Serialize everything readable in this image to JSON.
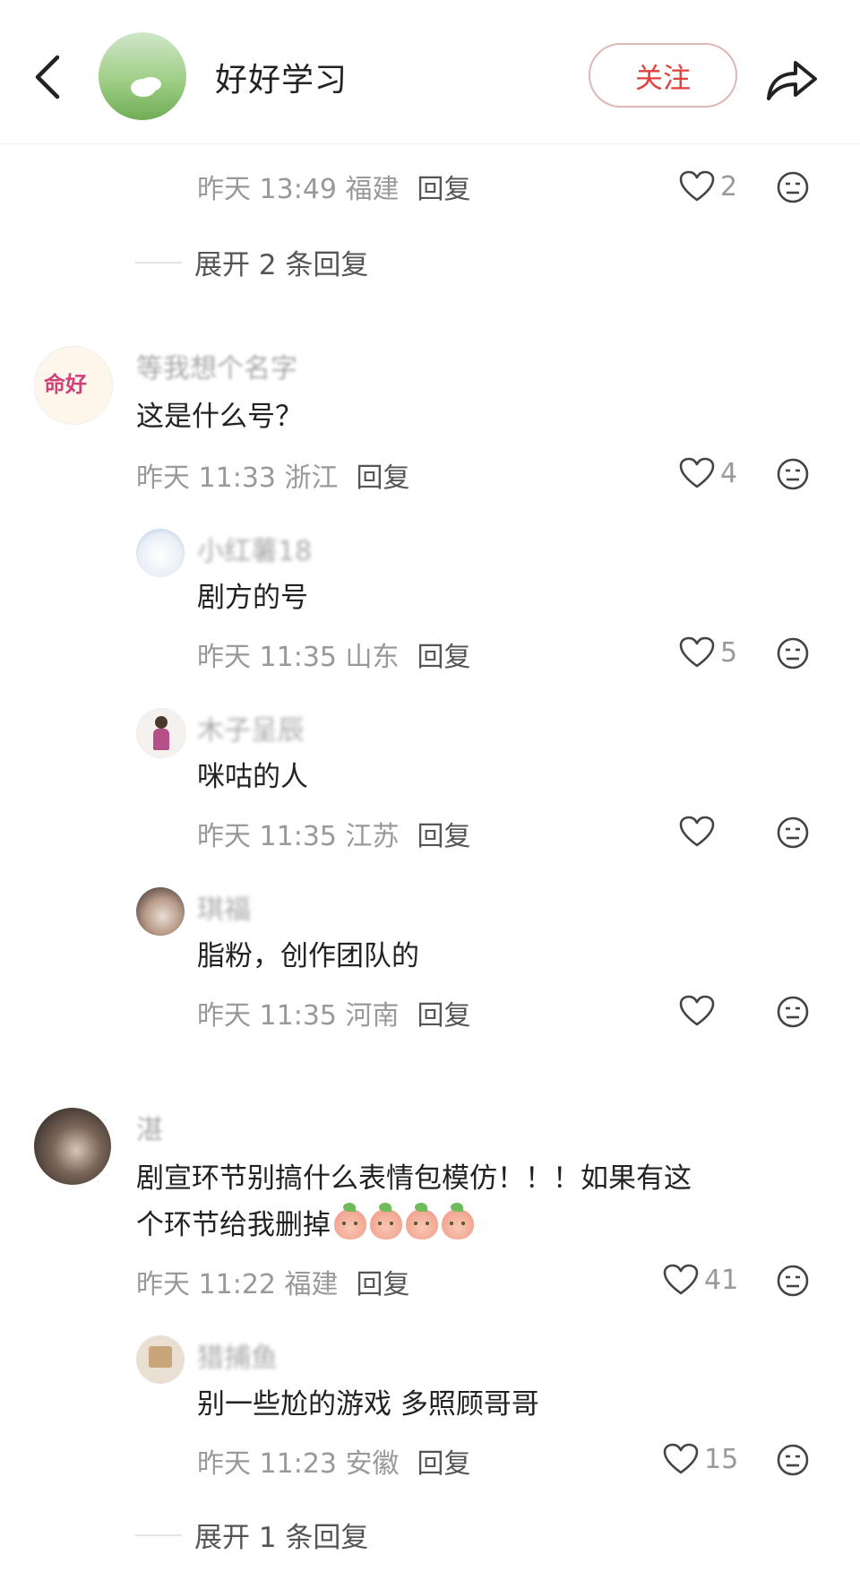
{
  "header": {
    "title": "好好学习",
    "follow_label": "关注",
    "icons": [
      "back-arrow-icon",
      "share-icon"
    ]
  },
  "top_partial": {
    "meta": "昨天 13:49 福建",
    "reply_label": "回复",
    "likes": "2",
    "expand_label": "展开 2 条回复"
  },
  "comments": [
    {
      "username": "等我想个名字",
      "avatar_text": "命好",
      "text": "这是什么号？",
      "meta": "昨天 11:33 浙江",
      "reply_label": "回复",
      "likes": "4",
      "replies": [
        {
          "username": "小红薯18",
          "text": "剧方的号",
          "meta": "昨天 11:35 山东",
          "reply_label": "回复",
          "likes": "5"
        },
        {
          "username": "木子呈辰",
          "text": "咪咕的人",
          "meta": "昨天 11:35 江苏",
          "reply_label": "回复",
          "likes": ""
        },
        {
          "username": "琪福",
          "text": "脂粉，创作团队的",
          "meta": "昨天 11:35 河南",
          "reply_label": "回复",
          "likes": ""
        }
      ]
    },
    {
      "username": "湛",
      "text_line1": "剧宣环节别搞什么表情包模仿！！！如果有这",
      "text_line2": "个环节给我删掉",
      "meta": "昨天 11:22 福建",
      "reply_label": "回复",
      "likes": "41",
      "replies": [
        {
          "username": "猎捕鱼",
          "text": "别一些尬的游戏 多照顾哥哥",
          "meta": "昨天 11:23 安徽",
          "reply_label": "回复",
          "likes": "15"
        }
      ],
      "expand_label": "展开 1 条回复"
    }
  ],
  "colors": {
    "accent": "#e0403e",
    "meta": "#999999",
    "text": "#222222"
  }
}
